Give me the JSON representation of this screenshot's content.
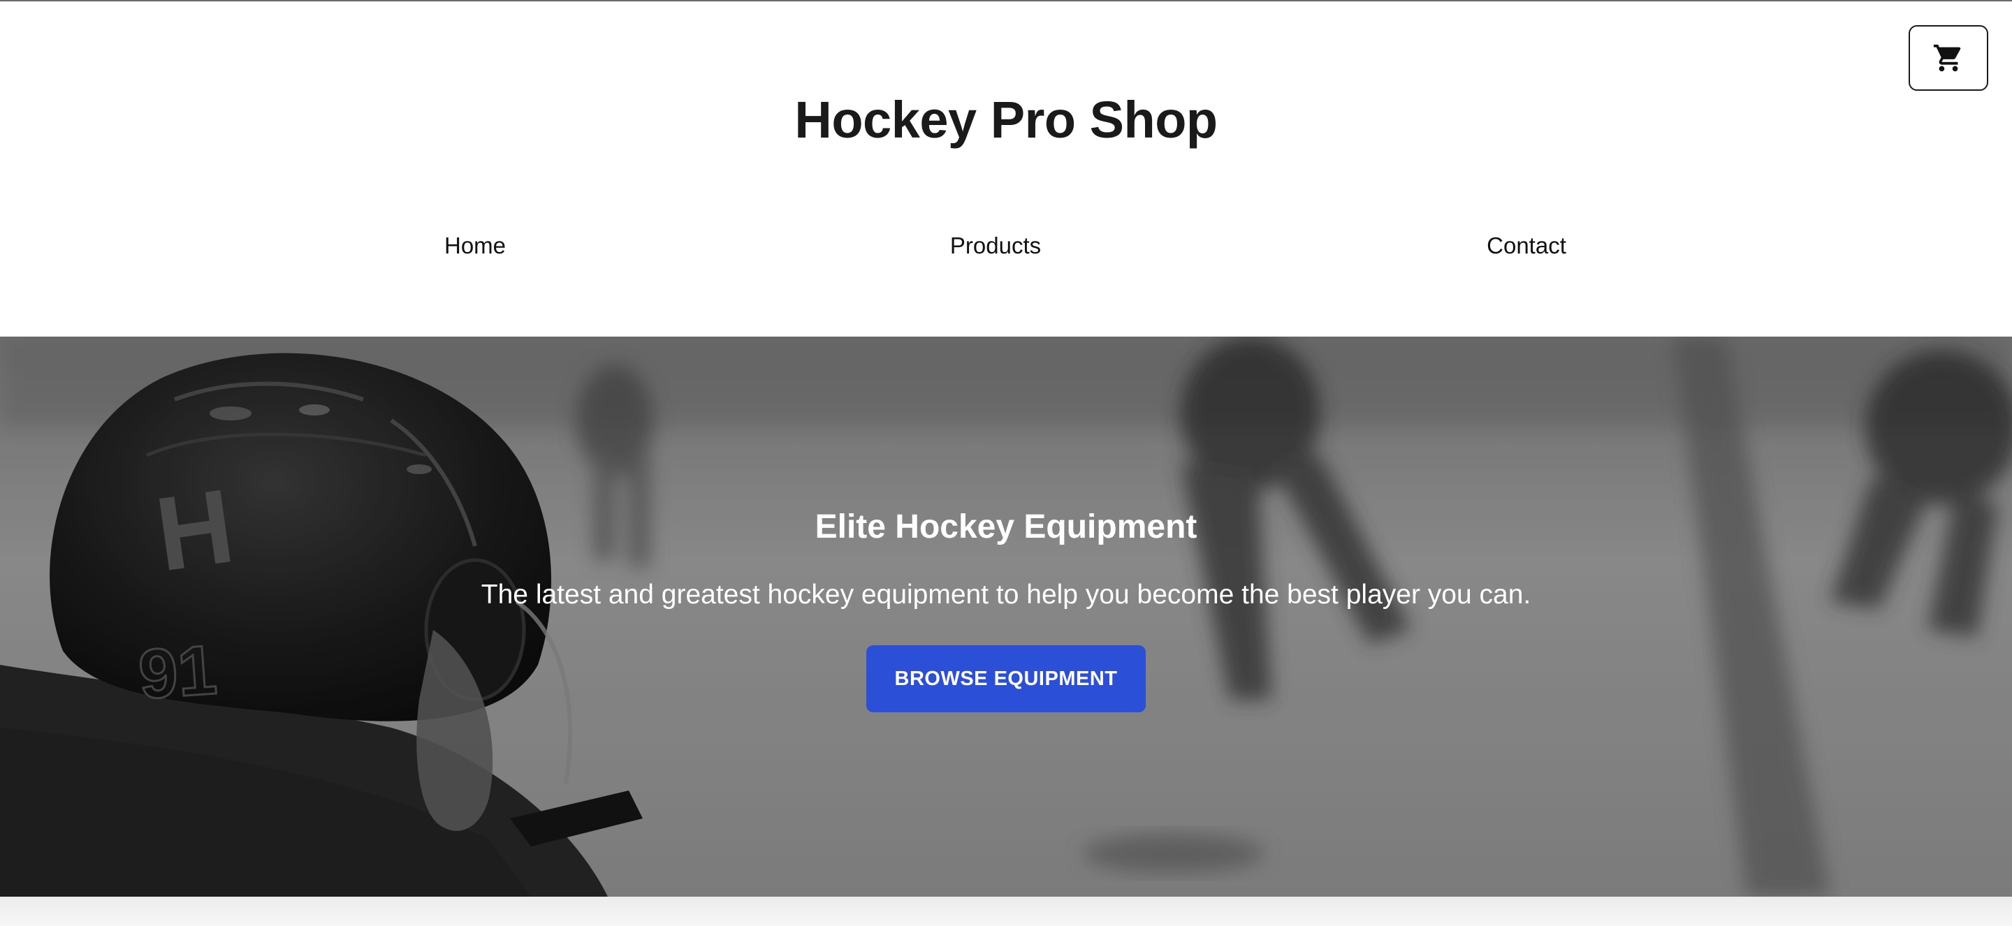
{
  "header": {
    "title": "Hockey Pro Shop",
    "cart_icon": "shopping-cart-icon"
  },
  "nav": {
    "items": [
      {
        "label": "Home"
      },
      {
        "label": "Products"
      },
      {
        "label": "Contact"
      }
    ]
  },
  "hero": {
    "heading": "Elite Hockey Equipment",
    "subtitle": "The latest and greatest hockey equipment to help you become the best player you can.",
    "button_label": "BROWSE EQUIPMENT",
    "button_color": "#2c4fd8",
    "helmet_letter": "H",
    "helmet_number": "91"
  }
}
